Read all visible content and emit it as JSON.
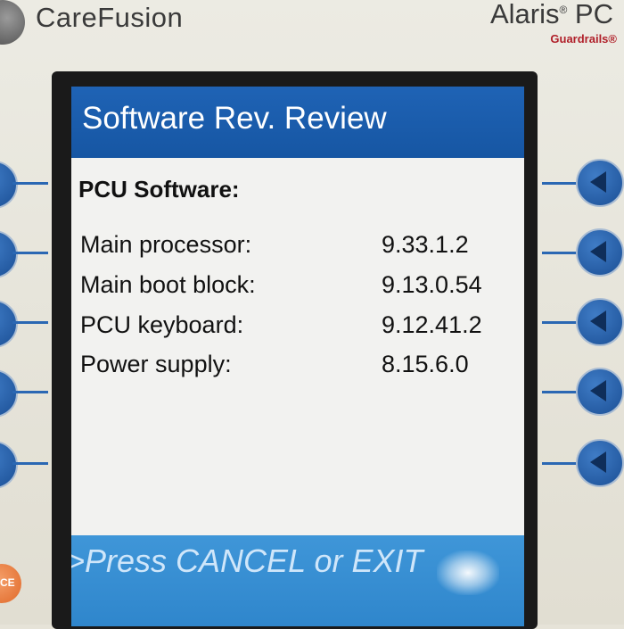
{
  "device": {
    "brand": "CareFusion",
    "model": "Alaris",
    "model_suffix": "PC",
    "model_sub": "Guardrails®"
  },
  "screen": {
    "title": "Software Rev. Review",
    "section_heading": "PCU Software:",
    "rows": [
      {
        "label": "Main processor:",
        "value": "9.33.1.2"
      },
      {
        "label": "Main boot block:",
        "value": "9.13.0.54"
      },
      {
        "label": "PCU keyboard:",
        "value": "9.12.41.2"
      },
      {
        "label": "Power supply:",
        "value": "8.15.6.0"
      }
    ],
    "footer_prompt": ">Press CANCEL or EXIT"
  },
  "hard_keys": {
    "cancel_label": "CE"
  },
  "colors": {
    "title_bar": "#1f63b5",
    "footer_bar": "#3f96d8",
    "key_blue": "#2a67b3",
    "cancel_orange": "#e0692a"
  }
}
